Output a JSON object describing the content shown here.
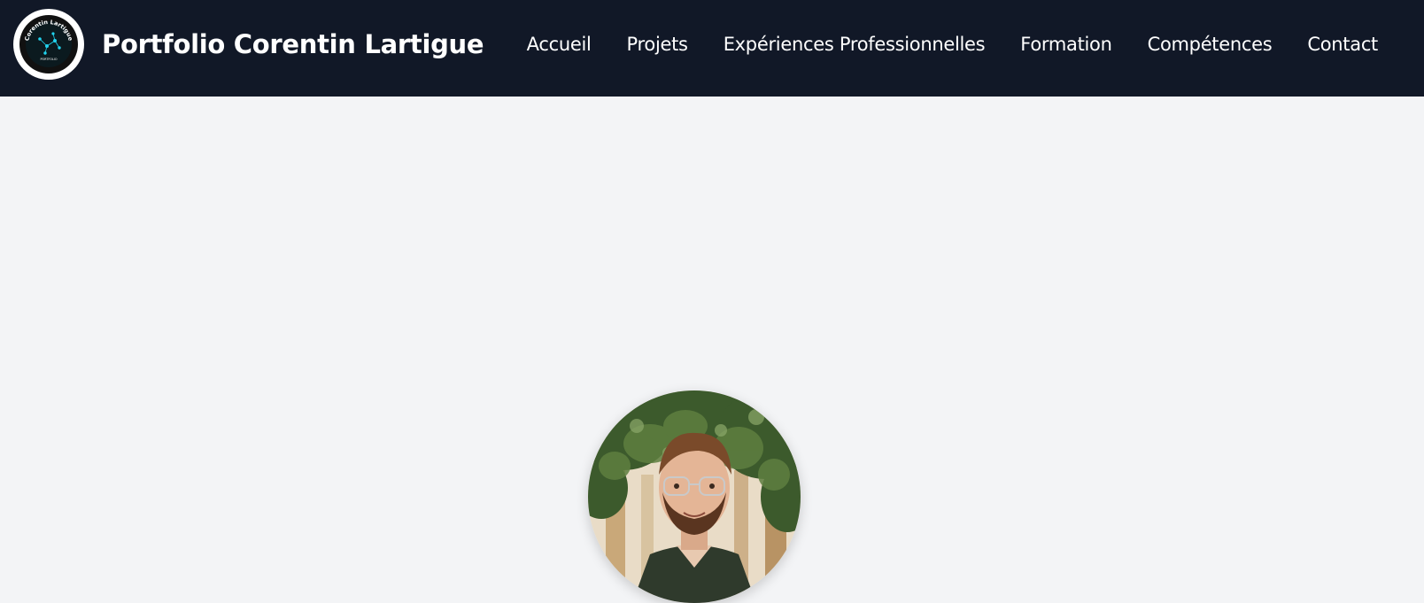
{
  "header": {
    "brand_title": "Portfolio Corentin Lartigue",
    "logo": {
      "icon": "constellation-logo-icon",
      "circular_text": "Corentin Lartigue",
      "sub_text": "PORTFOLIO"
    },
    "nav_items": [
      {
        "label": "Accueil"
      },
      {
        "label": "Projets"
      },
      {
        "label": "Expériences Professionnelles"
      },
      {
        "label": "Formation"
      },
      {
        "label": "Compétences"
      },
      {
        "label": "Contact"
      }
    ]
  },
  "hero": {
    "profile_photo": {
      "icon": "profile-photo"
    }
  },
  "colors": {
    "navbar_bg": "#111827",
    "page_bg": "#f3f4f6",
    "text_light": "#ffffff",
    "logo_accent": "#22d3ee"
  }
}
